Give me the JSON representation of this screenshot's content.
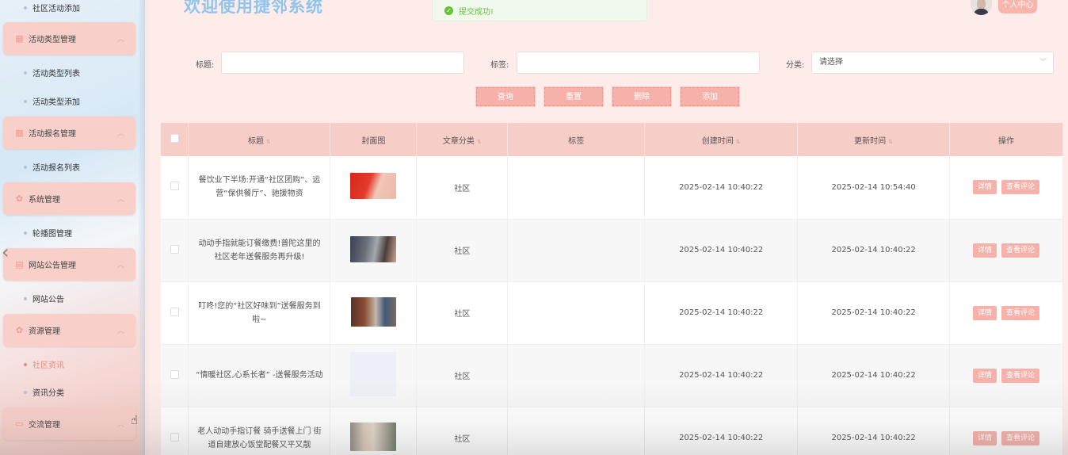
{
  "sidebar": {
    "items": [
      {
        "label": "社区活动添加"
      },
      {
        "label": "活动类型管理"
      },
      {
        "label": "活动类型列表"
      },
      {
        "label": "活动类型添加"
      },
      {
        "label": "活动报名管理"
      },
      {
        "label": "活动报名列表"
      },
      {
        "label": "系统管理"
      },
      {
        "label": "轮播图管理"
      },
      {
        "label": "网站公告管理"
      },
      {
        "label": "网站公告"
      },
      {
        "label": "资源管理"
      },
      {
        "label": "社区资讯"
      },
      {
        "label": "资讯分类"
      },
      {
        "label": "交流管理"
      }
    ]
  },
  "header": {
    "title": "欢迎使用捷邻系统",
    "toast": "提交成功!",
    "profile_label": "个人中心"
  },
  "search": {
    "title_label": "标题:",
    "tag_label": "标签:",
    "category_label": "分类:",
    "category_value": "请选择",
    "buttons": {
      "query": "查询",
      "reset": "重置",
      "delete": "删除",
      "add": "添加"
    }
  },
  "table": {
    "columns": [
      "标题",
      "封面图",
      "文章分类",
      "标签",
      "创建时间",
      "更新时间",
      "操作"
    ],
    "rows": [
      {
        "title": "餐饮业下半场:开通“社区团购”、运营“保供餐厅”、驰援物资",
        "category": "社区",
        "tag": "",
        "created": "2025-02-14 10:40:22",
        "updated": "2025-02-14 10:54:40"
      },
      {
        "title": "动动手指就能订餐缴费!普陀这里的社区老年送餐服务再升级!",
        "category": "社区",
        "tag": "",
        "created": "2025-02-14 10:40:22",
        "updated": "2025-02-14 10:40:22"
      },
      {
        "title": "叮咚!您的“社区好味到”送餐服务到啦~",
        "category": "社区",
        "tag": "",
        "created": "2025-02-14 10:40:22",
        "updated": "2025-02-14 10:40:22"
      },
      {
        "title": "“情暖社区,心系长者” -送餐服务活动",
        "category": "社区",
        "tag": "",
        "created": "2025-02-14 10:40:22",
        "updated": "2025-02-14 10:40:22"
      },
      {
        "title": "老人动动手指订餐 骑手送餐上门 街道自建放心饭堂配餐又平又靓",
        "category": "社区",
        "tag": "",
        "created": "2025-02-14 10:40:22",
        "updated": "2025-02-14 10:40:22"
      }
    ],
    "detail_label": "详情",
    "comment_label": "查看评论"
  }
}
